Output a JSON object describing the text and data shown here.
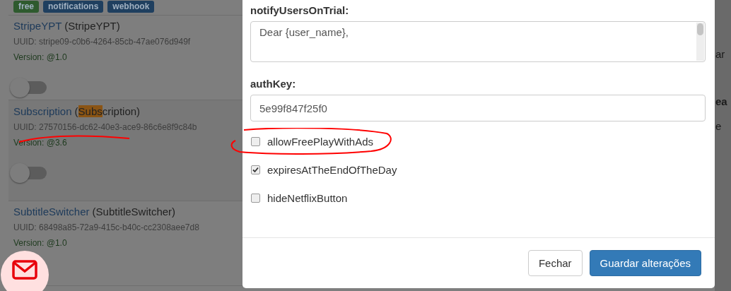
{
  "background": {
    "badges": [
      {
        "label": "free",
        "color": "#2e5a2e"
      },
      {
        "label": "notifications",
        "color": "#1f3f5f"
      },
      {
        "label": "webhook",
        "color": "#1f3f5f"
      }
    ],
    "plugins": [
      {
        "name": "StripeYPT",
        "alias": [
          {
            "text": "(StripeYPT)",
            "highlighted": false
          }
        ],
        "uuid": "UUID: stripe09-c0b6-4264-85cb-47ae076d949f",
        "version": "Version: @1.0",
        "on": false,
        "hovered": false
      },
      {
        "name": "Subscription",
        "alias": [
          {
            "text": "(",
            "highlighted": false
          },
          {
            "text": "Subs",
            "highlighted": true
          },
          {
            "text": "cription)",
            "highlighted": false
          }
        ],
        "uuid": "UUID: 27570156-dc62-40e3-ace9-86c6e8f9c84b",
        "version": "Version: @3.6",
        "on": false,
        "hovered": true
      },
      {
        "name": "SubtitleSwitcher",
        "alias": [
          {
            "text": "(SubtitleSwitcher)",
            "highlighted": false
          }
        ],
        "uuid": "UUID: 68498a85-72a9-415c-b40c-cc2308aee7d8",
        "version": "Version: @1.0"
      }
    ],
    "right_fragments": [
      {
        "text": "ar",
        "bold": false
      },
      {
        "text": "ea",
        "bold": true
      },
      {
        "text": "e",
        "bold": false
      }
    ]
  },
  "modal": {
    "fields": [
      {
        "kind": "textarea",
        "label": "notifyUsersOnTrial:",
        "value": "Dear {user_name},"
      },
      {
        "kind": "input",
        "label": "authKey:",
        "value": "5e99f847f25f0"
      },
      {
        "kind": "checkbox",
        "label": "allowFreePlayWithAds",
        "checked": false
      },
      {
        "kind": "checkbox",
        "label": "expiresAtTheEndOfTheDay",
        "checked": true
      },
      {
        "kind": "checkbox",
        "label": "hideNetflixButton",
        "checked": false
      }
    ],
    "buttons": [
      {
        "label": "Fechar",
        "kind": "default"
      },
      {
        "label": "Guardar alterações",
        "kind": "primary"
      }
    ]
  }
}
